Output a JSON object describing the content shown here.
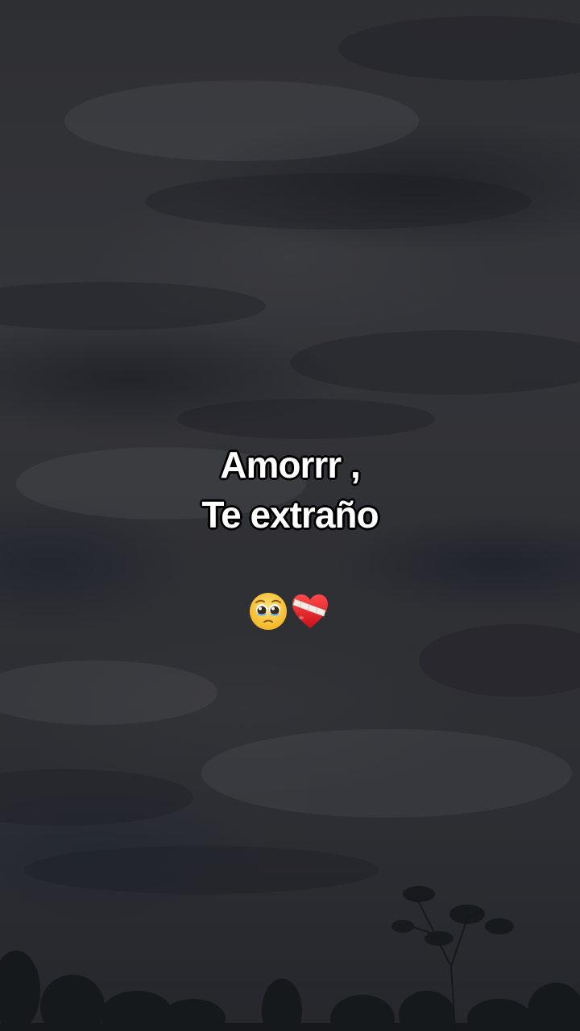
{
  "caption": {
    "line1": "Amorrr ,",
    "line2": "Te extraño"
  },
  "emojis": [
    {
      "name": "pleading-face-icon",
      "glyph": "🥺"
    },
    {
      "name": "mending-heart-icon",
      "glyph": "❤️‍🩹"
    }
  ],
  "colors": {
    "sky": "#2e2f33",
    "text": "#ffffff",
    "text_outline": "#000000"
  }
}
